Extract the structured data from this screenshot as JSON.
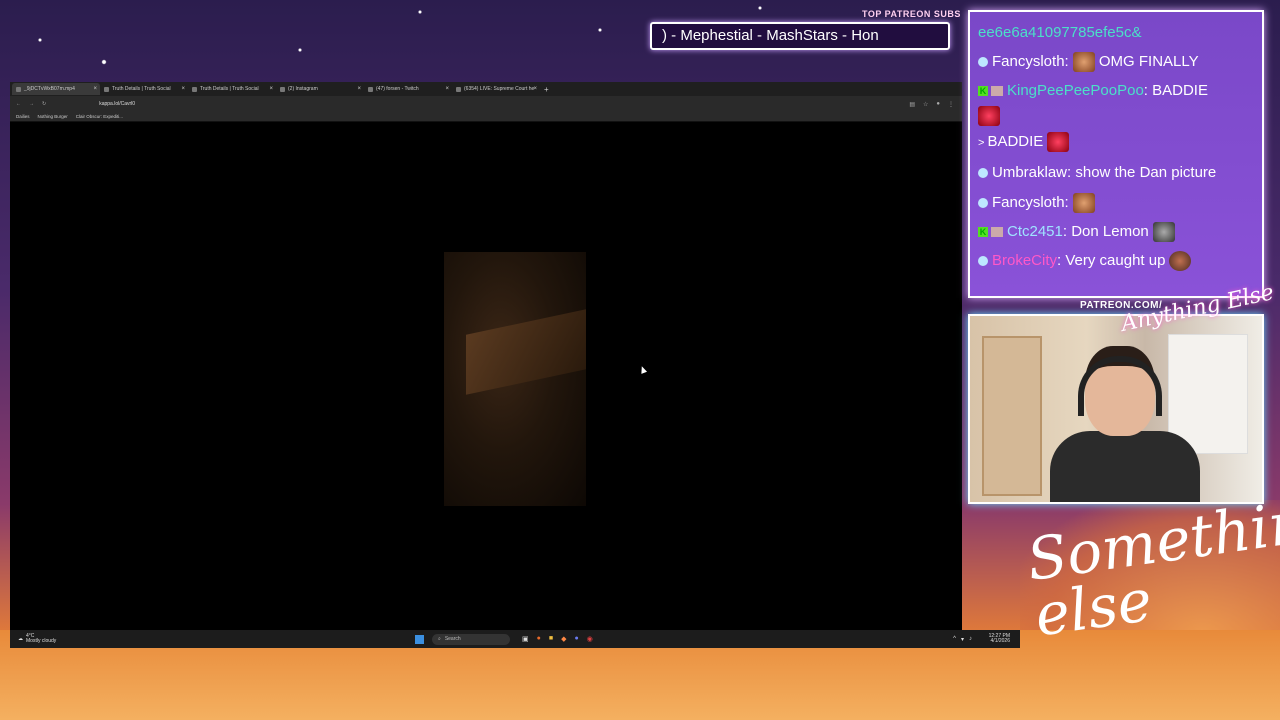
{
  "overlay": {
    "patreon_title": "TOP PATREON SUBS",
    "patreon_ticker": ") - Mephestial - MashStars - Hon",
    "patreon_url": "PATREON.COM/",
    "brand_script": "Anything Else",
    "logo_text": "Something else"
  },
  "browser": {
    "tabs": [
      {
        "label": "_9jDCTvWxB07m.mp4",
        "active": true
      },
      {
        "label": "Truth Details | Truth Social",
        "active": false
      },
      {
        "label": "Truth Details | Truth Social",
        "active": false
      },
      {
        "label": "(2) Instagram",
        "active": false
      },
      {
        "label": "(47) forsen - Twitch",
        "active": false
      },
      {
        "label": "(6354) LIVE: Supreme Court he",
        "active": false
      }
    ],
    "new_tab": "+",
    "url": "kappa.lol/Cavrl0",
    "bookmarks": [
      "Dailies",
      "Nothing Burger",
      "Clair Obscur: Expediti..."
    ]
  },
  "taskbar": {
    "weather_temp": "4°C",
    "weather_desc": "Mostly cloudy",
    "search_placeholder": "Search",
    "time": "12:27 PM",
    "date": "4/1/2026"
  },
  "chat": {
    "messages": [
      {
        "user": "ee6e6a41097785efe5c&",
        "text": "",
        "color": "#9fe3ff"
      },
      {
        "user": "Fancysloth",
        "text": "OMG FINALLY"
      },
      {
        "user": "KingPeePeePooPoo",
        "text": "BADDIE"
      },
      {
        "user": "",
        "text": "BADDIE"
      },
      {
        "user": "Umbraklaw",
        "text": "show the Dan picture"
      },
      {
        "user": "Fancysloth",
        "text": ""
      },
      {
        "user": "Ctc2451",
        "text": "Don Lemon"
      },
      {
        "user": "BrokeCity",
        "text": "Very caught up"
      }
    ]
  },
  "colors": {
    "chat_bg": "#8a52d8",
    "accent_pink": "#ff58c8",
    "accent_teal": "#4be0c8"
  }
}
